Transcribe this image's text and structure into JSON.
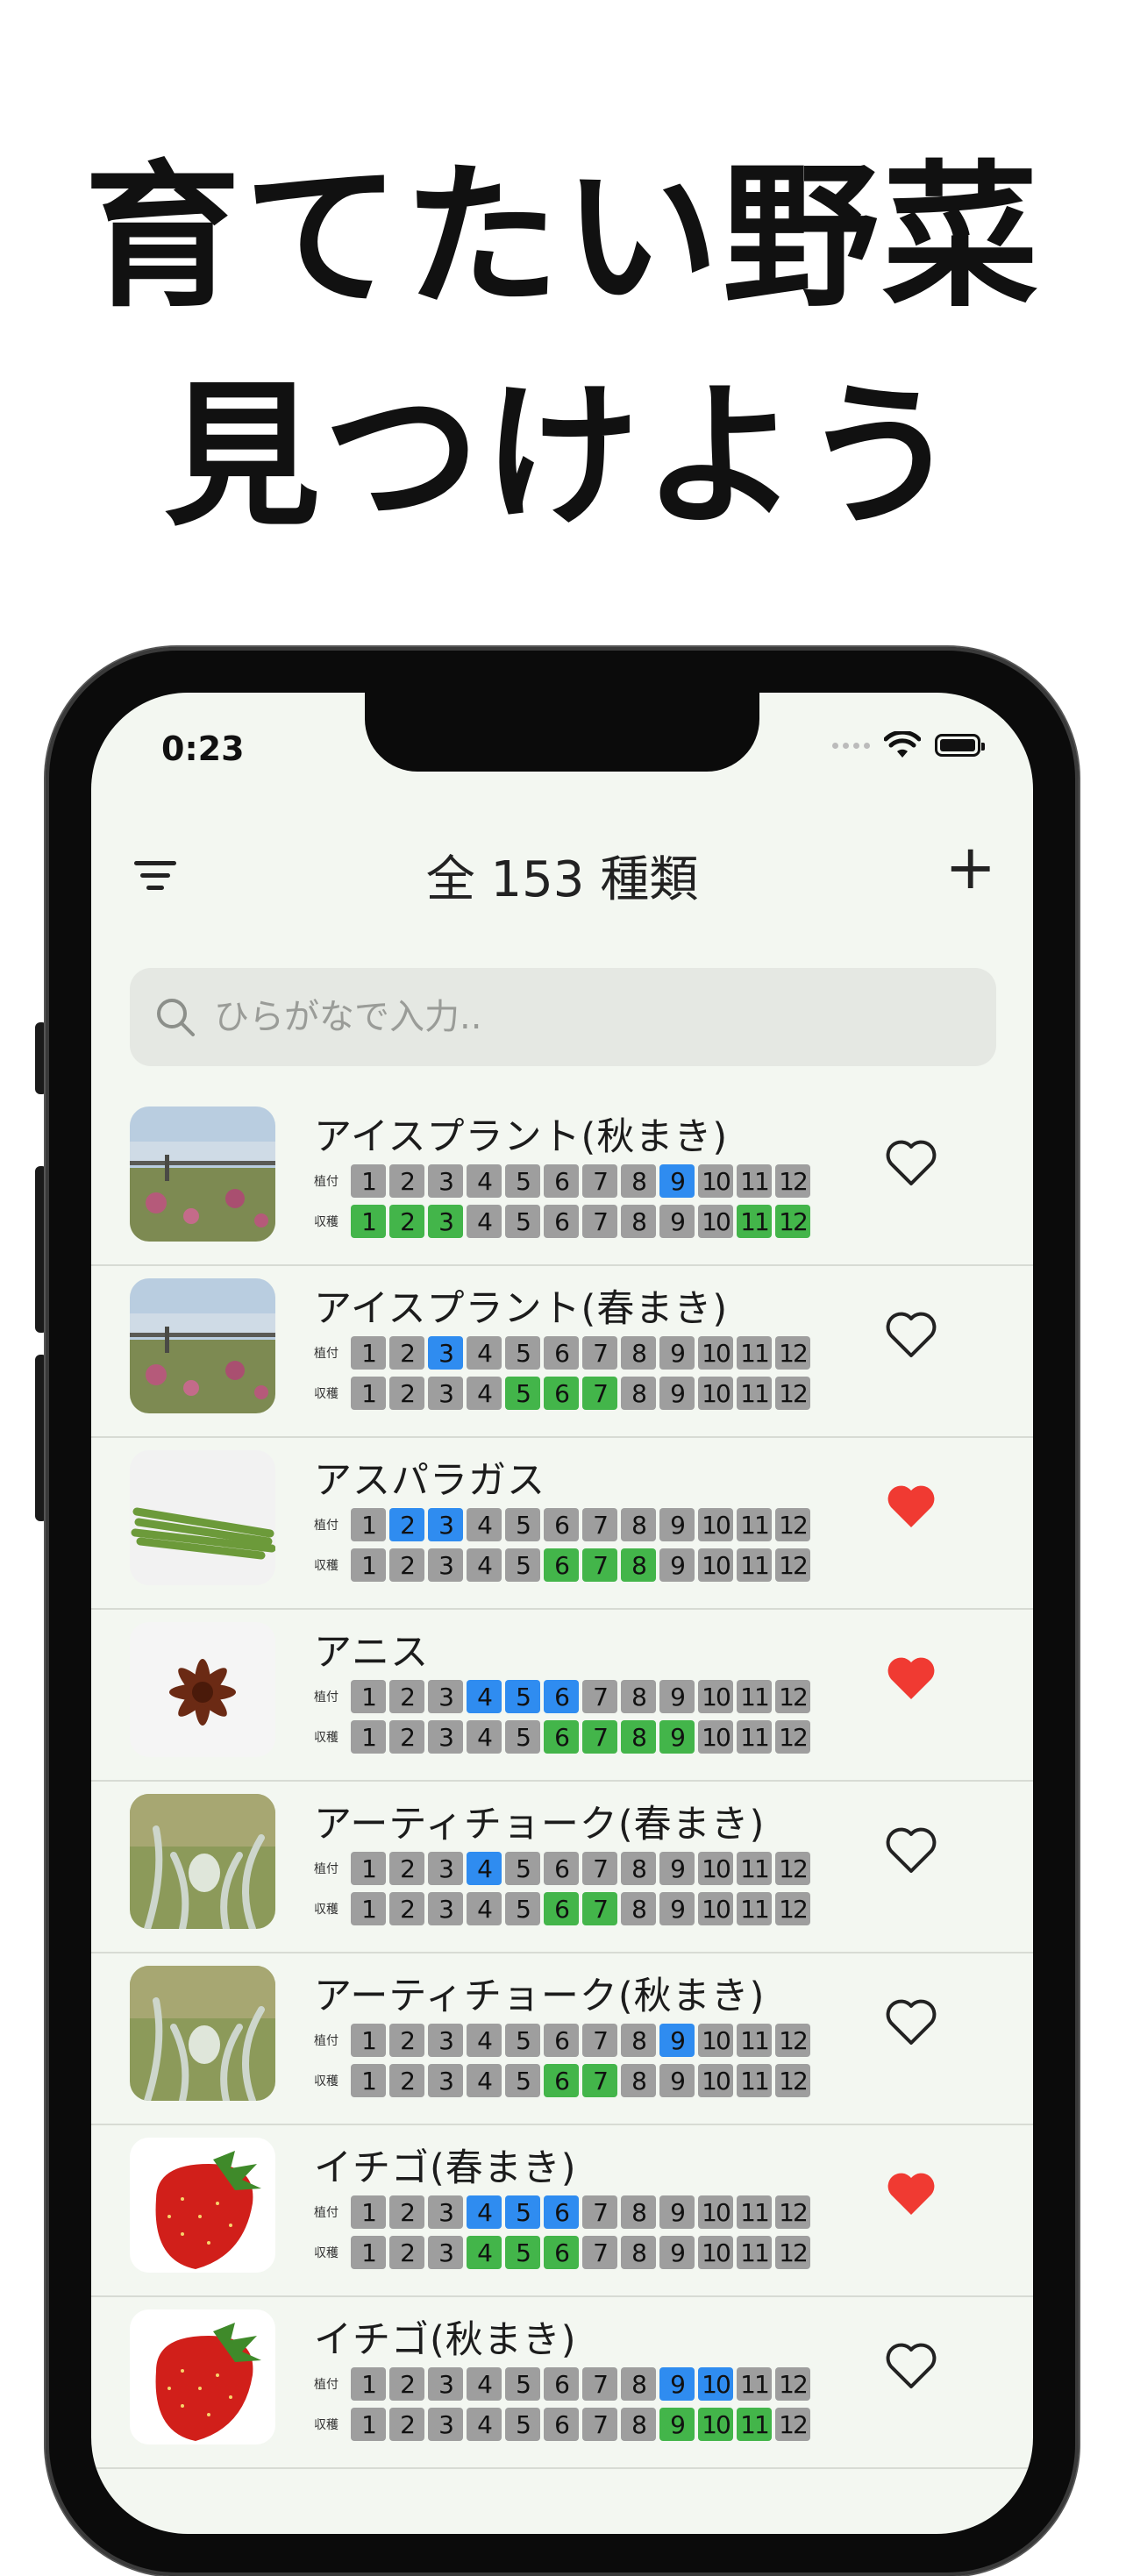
{
  "headline": {
    "line1": "育てたい野菜",
    "line2": "見つけよう"
  },
  "status_bar": {
    "time": "0:23"
  },
  "header": {
    "title": "全 153 種類",
    "add_label": "+"
  },
  "search": {
    "placeholder": "ひらがなで入力.."
  },
  "labels": {
    "sow": "植付",
    "harvest": "収穫"
  },
  "colors": {
    "sow": "#2f8cf0",
    "harvest": "#43b54a",
    "inactive": "#9e9e9e",
    "favorite": "#f03a32",
    "background": "#f3f7f1"
  },
  "vegetables": [
    {
      "name": "アイスプラント(秋まき)",
      "image": "ice-plant-photo",
      "sow": [
        9
      ],
      "harvest": [
        1,
        2,
        3,
        11,
        12
      ],
      "favorite": false
    },
    {
      "name": "アイスプラント(春まき)",
      "image": "ice-plant-photo",
      "sow": [
        3
      ],
      "harvest": [
        5,
        6,
        7
      ],
      "favorite": false
    },
    {
      "name": "アスパラガス",
      "image": "asparagus-photo",
      "sow": [
        2,
        3
      ],
      "harvest": [
        6,
        7,
        8
      ],
      "favorite": true
    },
    {
      "name": "アニス",
      "image": "star-anise-photo",
      "sow": [
        4,
        5,
        6
      ],
      "harvest": [
        6,
        7,
        8,
        9
      ],
      "favorite": true
    },
    {
      "name": "アーティチョーク(春まき)",
      "image": "artichoke-photo",
      "sow": [
        4
      ],
      "harvest": [
        6,
        7
      ],
      "favorite": false
    },
    {
      "name": "アーティチョーク(秋まき)",
      "image": "artichoke-photo",
      "sow": [
        9
      ],
      "harvest": [
        6,
        7
      ],
      "favorite": false
    },
    {
      "name": "イチゴ(春まき)",
      "image": "strawberry-photo",
      "sow": [
        4,
        5,
        6
      ],
      "harvest": [
        4,
        5,
        6
      ],
      "favorite": true
    },
    {
      "name": "イチゴ(秋まき)",
      "image": "strawberry-photo",
      "sow": [
        9,
        10
      ],
      "harvest": [
        9,
        10,
        11
      ],
      "favorite": false
    }
  ]
}
